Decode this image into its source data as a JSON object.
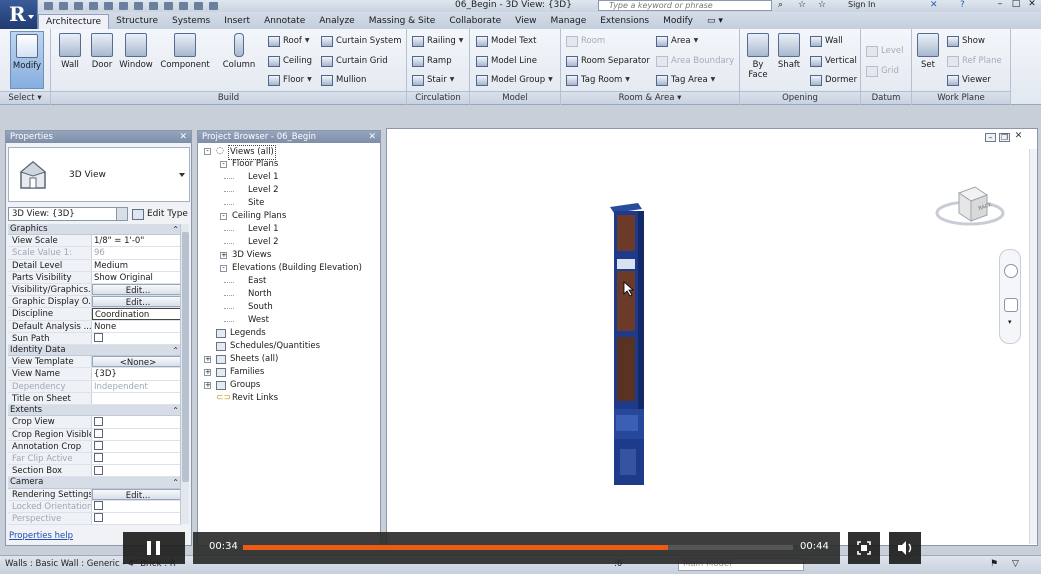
{
  "titlebar": {
    "doc_title": "06_Begin - 3D View: {3D}",
    "search_placeholder": "Type a keyword or phrase",
    "sign_in": "Sign In"
  },
  "tabs": [
    "Architecture",
    "Structure",
    "Systems",
    "Insert",
    "Annotate",
    "Analyze",
    "Massing & Site",
    "Collaborate",
    "View",
    "Manage",
    "Extensions",
    "Modify"
  ],
  "ribbon": {
    "panels": [
      "Select",
      "Build",
      "Circulation",
      "Model",
      "Room & Area",
      "Opening",
      "Datum",
      "Work Plane"
    ],
    "select": {
      "modify": "Modify"
    },
    "build": {
      "wall": "Wall",
      "door": "Door",
      "window": "Window",
      "component": "Component",
      "column": "Column",
      "roof": "Roof",
      "ceiling": "Ceiling",
      "floor": "Floor",
      "curtain_system": "Curtain System",
      "curtain_grid": "Curtain Grid",
      "mullion": "Mullion"
    },
    "circulation": {
      "railing": "Railing",
      "ramp": "Ramp",
      "stair": "Stair"
    },
    "model": {
      "model_text": "Model Text",
      "model_line": "Model Line",
      "model_group": "Model Group"
    },
    "room_area": {
      "room": "Room",
      "room_separator": "Room Separator",
      "tag_room": "Tag Room",
      "area": "Area",
      "area_boundary": "Area Boundary",
      "tag_area": "Tag Area"
    },
    "opening": {
      "by_face": "By Face",
      "shaft": "Shaft",
      "wall": "Wall",
      "vertical": "Vertical",
      "dormer": "Dormer"
    },
    "datum": {
      "level": "Level",
      "grid": "Grid"
    },
    "work_plane": {
      "set": "Set",
      "show": "Show",
      "ref_plane": "Ref Plane",
      "viewer": "Viewer"
    }
  },
  "properties": {
    "title": "Properties",
    "type_name": "3D View",
    "view_filter": "3D View: {3D}",
    "edit_type": "Edit Type",
    "help": "Properties help",
    "groups": [
      {
        "name": "Graphics",
        "rows": [
          {
            "k": "View Scale",
            "v": "1/8\" = 1'-0\""
          },
          {
            "k": "Scale Value    1:",
            "v": "96",
            "dis": true
          },
          {
            "k": "Detail Level",
            "v": "Medium"
          },
          {
            "k": "Parts Visibility",
            "v": "Show Original"
          },
          {
            "k": "Visibility/Graphics...",
            "v": "Edit...",
            "btn": true
          },
          {
            "k": "Graphic Display O...",
            "v": "Edit...",
            "btn": true
          },
          {
            "k": "Discipline",
            "v": "Coordination",
            "boxed": true
          },
          {
            "k": "Default Analysis ...",
            "v": "None"
          },
          {
            "k": "Sun Path",
            "v": "",
            "chk": true
          }
        ]
      },
      {
        "name": "Identity Data",
        "rows": [
          {
            "k": "View Template",
            "v": "<None>",
            "btn": true
          },
          {
            "k": "View Name",
            "v": "{3D}"
          },
          {
            "k": "Dependency",
            "v": "Independent",
            "dis": true
          },
          {
            "k": "Title on Sheet",
            "v": ""
          }
        ]
      },
      {
        "name": "Extents",
        "rows": [
          {
            "k": "Crop View",
            "v": "",
            "chk": true
          },
          {
            "k": "Crop Region Visible",
            "v": "",
            "chk": true
          },
          {
            "k": "Annotation Crop",
            "v": "",
            "chk": true
          },
          {
            "k": "Far Clip Active",
            "v": "",
            "chk": true,
            "dis": true
          },
          {
            "k": "Section Box",
            "v": "",
            "chk": true
          }
        ]
      },
      {
        "name": "Camera",
        "rows": [
          {
            "k": "Rendering Settings",
            "v": "Edit...",
            "btn": true
          },
          {
            "k": "Locked Orientation",
            "v": "",
            "chk": true,
            "dis": true
          },
          {
            "k": "Perspective",
            "v": "",
            "chk": true,
            "dis": true
          }
        ]
      }
    ]
  },
  "browser": {
    "title": "Project Browser - 06_Begin",
    "nodes": [
      {
        "label": "Views (all)",
        "level": 0,
        "toggle": "-",
        "sel": true
      },
      {
        "label": "Floor Plans",
        "level": 1,
        "toggle": "-"
      },
      {
        "label": "Level 1",
        "level": 2
      },
      {
        "label": "Level 2",
        "level": 2
      },
      {
        "label": "Site",
        "level": 2
      },
      {
        "label": "Ceiling Plans",
        "level": 1,
        "toggle": "-"
      },
      {
        "label": "Level 1",
        "level": 2
      },
      {
        "label": "Level 2",
        "level": 2
      },
      {
        "label": "3D Views",
        "level": 1,
        "toggle": "+"
      },
      {
        "label": "Elevations (Building Elevation)",
        "level": 1,
        "toggle": "-"
      },
      {
        "label": "East",
        "level": 2
      },
      {
        "label": "North",
        "level": 2
      },
      {
        "label": "South",
        "level": 2
      },
      {
        "label": "West",
        "level": 2
      },
      {
        "label": "Legends",
        "level": 0,
        "icon": true
      },
      {
        "label": "Schedules/Quantities",
        "level": 0,
        "icon": true
      },
      {
        "label": "Sheets (all)",
        "level": 0,
        "toggle": "+",
        "icon": true
      },
      {
        "label": "Families",
        "level": 0,
        "toggle": "+",
        "icon": true
      },
      {
        "label": "Groups",
        "level": 0,
        "toggle": "+",
        "icon": true
      },
      {
        "label": "Revit Links",
        "level": 0,
        "link": true
      }
    ]
  },
  "viewport": {
    "viewcube_face": "BACK"
  },
  "statusbar": {
    "text": "Walls : Basic Wall : Generic - 4\" Brick : R",
    "zero": ":0",
    "model": "Main Model"
  },
  "player": {
    "current": "00:34",
    "duration": "00:44",
    "progress": 0.773
  },
  "colors": {
    "accent_orange": "#ec5a16",
    "ribbon_blue": "#1f3a6e",
    "model_blue": "#1e3a8a",
    "brick": "#7a3b22"
  }
}
